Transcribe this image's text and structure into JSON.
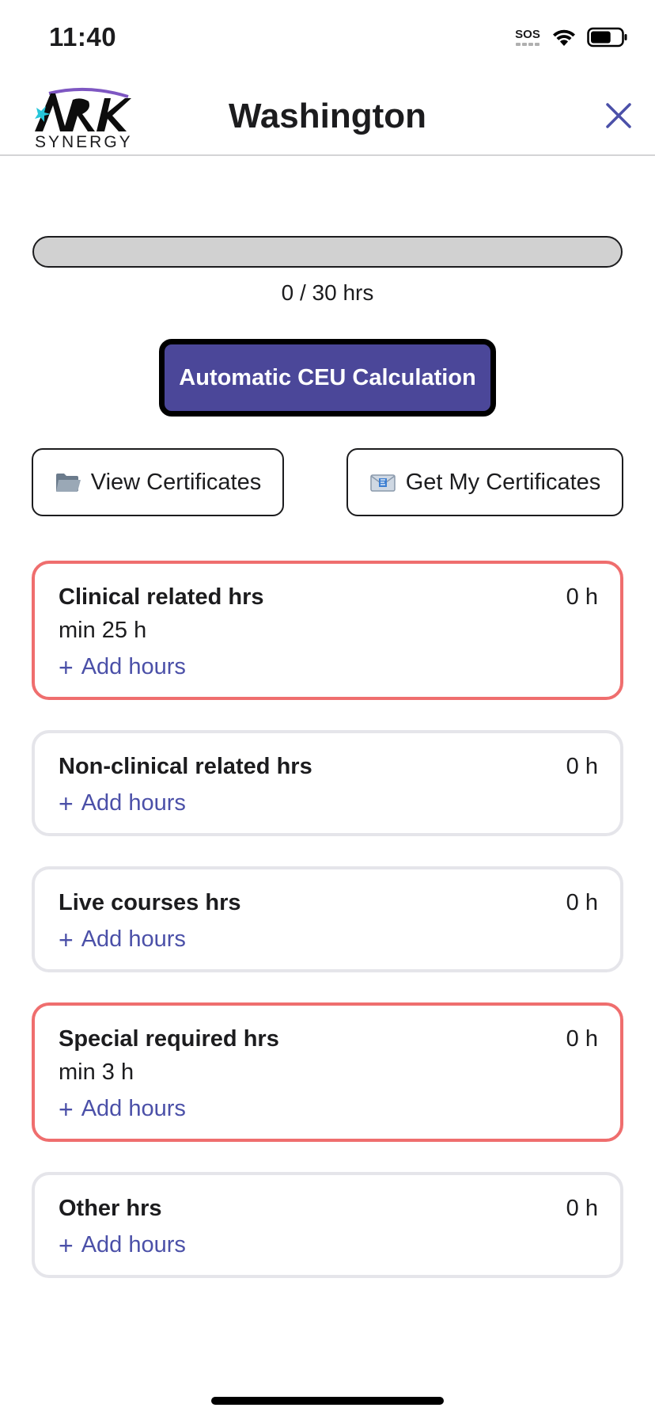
{
  "status_bar": {
    "time": "11:40",
    "sos_label": "SOS",
    "battery_percent": 65
  },
  "header": {
    "logo_text": "SYNERGY",
    "title": "Washington",
    "close_icon": "close-icon"
  },
  "progress": {
    "completed_hours": 0,
    "required_hours": 30,
    "label": "0 / 30 hrs"
  },
  "ceu_button": {
    "label": "Automatic CEU Calculation",
    "color": "#4b4799"
  },
  "certificates": {
    "view_label": "View Certificates",
    "view_icon": "folder-icon",
    "get_label": "Get My Certificates",
    "get_icon": "envelope-icon"
  },
  "categories": [
    {
      "title": "Clinical related hrs",
      "hours": "0 h",
      "minimum": "min 25 h",
      "add_label": "Add hours",
      "required": true
    },
    {
      "title": "Non-clinical related hrs",
      "hours": "0 h",
      "minimum": "",
      "add_label": "Add hours",
      "required": false
    },
    {
      "title": "Live courses hrs",
      "hours": "0 h",
      "minimum": "",
      "add_label": "Add hours",
      "required": false
    },
    {
      "title": "Special required hrs",
      "hours": "0 h",
      "minimum": "min 3 h",
      "add_label": "Add hours",
      "required": true
    },
    {
      "title": "Other hrs",
      "hours": "0 h",
      "minimum": "",
      "add_label": "Add hours",
      "required": false
    }
  ],
  "colors": {
    "accent": "#4b4799",
    "link": "#4b50a8",
    "required_border": "#ef6e6e",
    "default_border": "#e5e5ea"
  }
}
